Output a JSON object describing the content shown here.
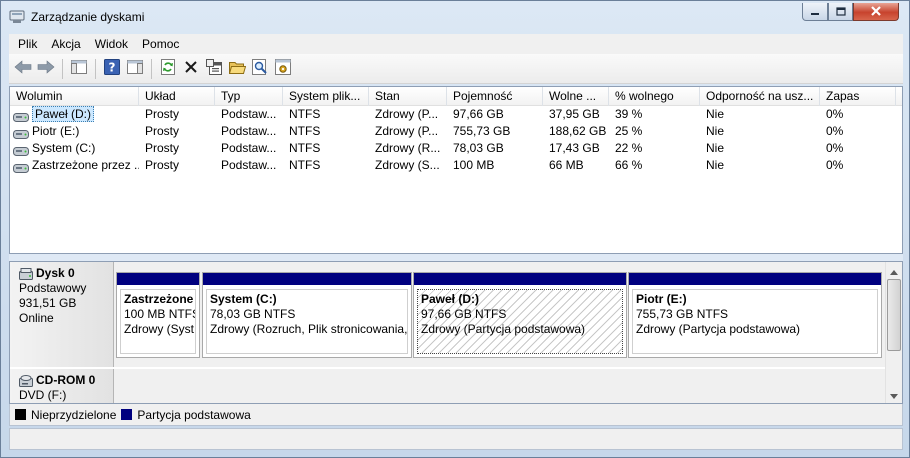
{
  "window": {
    "title": "Zarządzanie dyskami",
    "icon": "disk-management-icon",
    "controls": [
      "minimize-icon",
      "maximize-icon",
      "close-icon"
    ]
  },
  "menu": [
    "Plik",
    "Akcja",
    "Widok",
    "Pomoc"
  ],
  "toolbar": [
    "back-arrow-icon",
    "forward-arrow-icon",
    "console-tree-icon",
    "help-icon",
    "action-pane-icon",
    "refresh-icon",
    "delete-icon",
    "properties-icon",
    "open-folder-icon",
    "search-icon",
    "settings-icon"
  ],
  "columns": [
    "Wolumin",
    "Układ",
    "Typ",
    "System plik...",
    "Stan",
    "Pojemność",
    "Wolne ...",
    "% wolnego",
    "Odporność na usz...",
    "Zapas"
  ],
  "volumes": [
    {
      "name": "Paweł (D:)",
      "layout": "Prosty",
      "type": "Podstaw...",
      "fs": "NTFS",
      "status": "Zdrowy (P...",
      "capacity": "97,66 GB",
      "free": "37,95 GB",
      "pct": "39 %",
      "fault": "Nie",
      "overhead": "0%",
      "selected": true
    },
    {
      "name": "Piotr (E:)",
      "layout": "Prosty",
      "type": "Podstaw...",
      "fs": "NTFS",
      "status": "Zdrowy (P...",
      "capacity": "755,73 GB",
      "free": "188,62 GB",
      "pct": "25 %",
      "fault": "Nie",
      "overhead": "0%"
    },
    {
      "name": "System (C:)",
      "layout": "Prosty",
      "type": "Podstaw...",
      "fs": "NTFS",
      "status": "Zdrowy (R...",
      "capacity": "78,03 GB",
      "free": "17,43 GB",
      "pct": "22 %",
      "fault": "Nie",
      "overhead": "0%"
    },
    {
      "name": "Zastrzeżone przez ...",
      "layout": "Prosty",
      "type": "Podstaw...",
      "fs": "NTFS",
      "status": "Zdrowy (S...",
      "capacity": "100 MB",
      "free": "66 MB",
      "pct": "66 %",
      "fault": "Nie",
      "overhead": "0%"
    }
  ],
  "disks": [
    {
      "name": "Dysk 0",
      "line1": "Podstawowy",
      "line2": "931,51 GB",
      "line3": "Online",
      "partitions": [
        {
          "name": "Zastrzeżone",
          "size": "100 MB NTFS",
          "status": "Zdrowy (Syst"
        },
        {
          "name": "System  (C:)",
          "size": "78,03 GB NTFS",
          "status": "Zdrowy (Rozruch, Plik stronicowania,"
        },
        {
          "name": "Paweł  (D:)",
          "size": "97,66 GB NTFS",
          "status": "Zdrowy (Partycja podstawowa)",
          "selected": true
        },
        {
          "name": "Piotr  (E:)",
          "size": "755,73 GB NTFS",
          "status": "Zdrowy (Partycja podstawowa)"
        }
      ]
    },
    {
      "name": "CD-ROM 0",
      "line1": "DVD (F:)"
    }
  ],
  "legend": [
    {
      "label": "Nieprzydzielone",
      "color": "#000000"
    },
    {
      "label": "Partycja podstawowa",
      "color": "#00007f"
    }
  ]
}
